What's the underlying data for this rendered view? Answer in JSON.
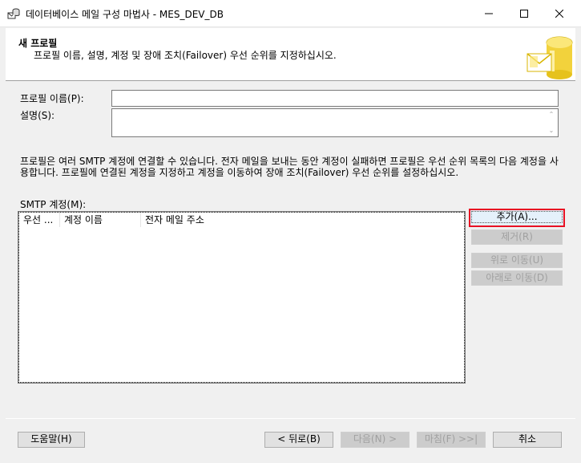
{
  "window": {
    "title": "데이터베이스 메일 구성 마법사 - MES_DEV_DB",
    "icon": "database-mail-icon"
  },
  "header": {
    "title": "새 프로필",
    "description": "프로필 이름, 설명, 계정 및 장애 조치(Failover) 우선 순위를 지정하십시오."
  },
  "form": {
    "profile_name_label": "프로필 이름(P):",
    "profile_name_value": "",
    "description_label": "설명(S):",
    "description_value": ""
  },
  "info_text": "프로필은 여러 SMTP 계정에 연결할 수 있습니다. 전자 메일을 보내는 동안 계정이 실패하면 프로필은 우선 순위 목록의 다음 계정을 사용합니다. 프로필에 연결된 계정을 지정하고 계정을 이동하여 장애 조치(Failover) 우선 순위를 설정하십시오.",
  "smtp": {
    "label": "SMTP 계정(M):",
    "columns": [
      "우선 ...",
      "계정 이름",
      "전자 메일 주소"
    ],
    "rows": []
  },
  "side_buttons": {
    "add": "추가(A)...",
    "remove": "제거(R)",
    "move_up": "위로 이동(U)",
    "move_down": "아래로 이동(D)"
  },
  "footer": {
    "help": "도움말(H)",
    "back": "< 뒤로(B)",
    "next": "다음(N) >",
    "finish": "마침(F) >>|",
    "cancel": "취소"
  },
  "colors": {
    "focus_border": "#e81123",
    "disabled_text": "#a0a0a0"
  }
}
